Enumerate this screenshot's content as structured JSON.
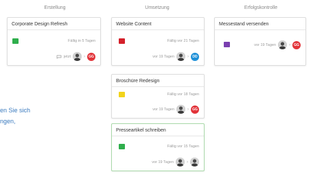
{
  "columns": [
    {
      "title": "Erstellung"
    },
    {
      "title": "Umsetzung"
    },
    {
      "title": "Erfolgskontrolle"
    }
  ],
  "cards": [
    {
      "title": "Corporate Design Refresh",
      "label_color": "#2fae4c",
      "due": "Fällig in 5 Tagen",
      "updated": "jetzt",
      "assignee_initials": "GG",
      "assignee_color": "#e2343a"
    },
    {
      "title": "Website Content",
      "label_color": "#d4202a",
      "due": "Fällig vor 21 Tagen",
      "updated": "vor 19 Tagen",
      "assignee_initials": "DD",
      "assignee_color": "#1e90d8"
    },
    {
      "title": "Broschüre Redesign",
      "label_color": "#f2d31b",
      "due": "Fällig vor 18 Tagen",
      "updated": "vor 19 Tagen",
      "assignee_initials": "GG",
      "assignee_color": "#e2343a"
    },
    {
      "title": "Presseartikel schreiben",
      "label_color": "#2fae4c",
      "due": "Fällig vor 15 Tagen",
      "updated": "vor 19 Tagen"
    },
    {
      "title": "Messestand versenden",
      "label_color": "#7a3fb0",
      "updated": "vor 19 Tagen",
      "assignee_initials": "GG",
      "assignee_color": "#e2343a"
    }
  ],
  "side_text": {
    "line1": "en Sie sich",
    "line2": "ngen,"
  }
}
